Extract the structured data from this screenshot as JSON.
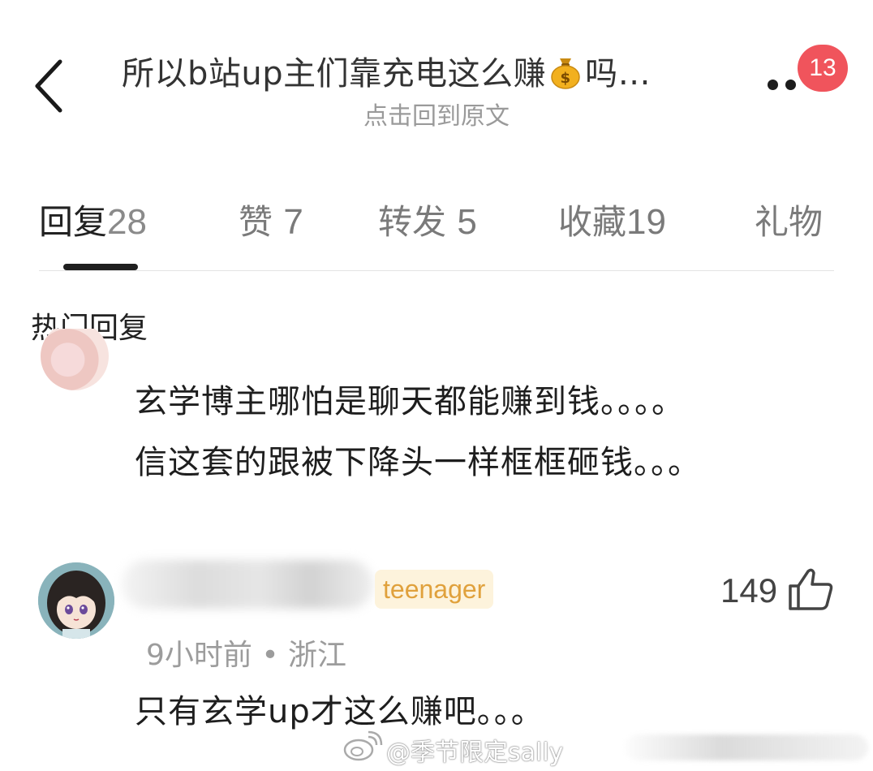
{
  "header": {
    "title_before": "所以b站up主们靠充电这么赚",
    "title_emoji_icon": "money-bag-icon",
    "title_after": "吗…",
    "subtitle": "点击回到原文",
    "badge_count": "13",
    "back_icon": "chevron-left-icon",
    "more_icon": "more-dots-icon"
  },
  "tabs": [
    {
      "label": "回复",
      "count": "28"
    },
    {
      "label": "赞",
      "count": "7"
    },
    {
      "label": "转发",
      "count": "5"
    },
    {
      "label": "收藏",
      "count": "19"
    },
    {
      "label": "礼物",
      "count": ""
    }
  ],
  "active_tab": "回复",
  "section": {
    "title": "热门回复"
  },
  "comments": [
    {
      "text_line1": "玄学博主哪怕是聊天都能赚到钱。。。。",
      "text_line2": "信这套的跟被下降头一样框框砸钱。。。"
    },
    {
      "tag": "teenager",
      "likes": "149",
      "like_icon": "thumbs-up-icon",
      "meta": "9小时前 • 浙江",
      "text": "只有玄学up才这么赚吧。。。"
    }
  ],
  "watermark": {
    "text": "@季节限定sally",
    "icon": "weibo-icon"
  },
  "colors": {
    "badge": "#f0545c",
    "tag_text": "#e0a13c",
    "tag_bg": "#fdf3dc",
    "muted": "#9a9a9a"
  }
}
